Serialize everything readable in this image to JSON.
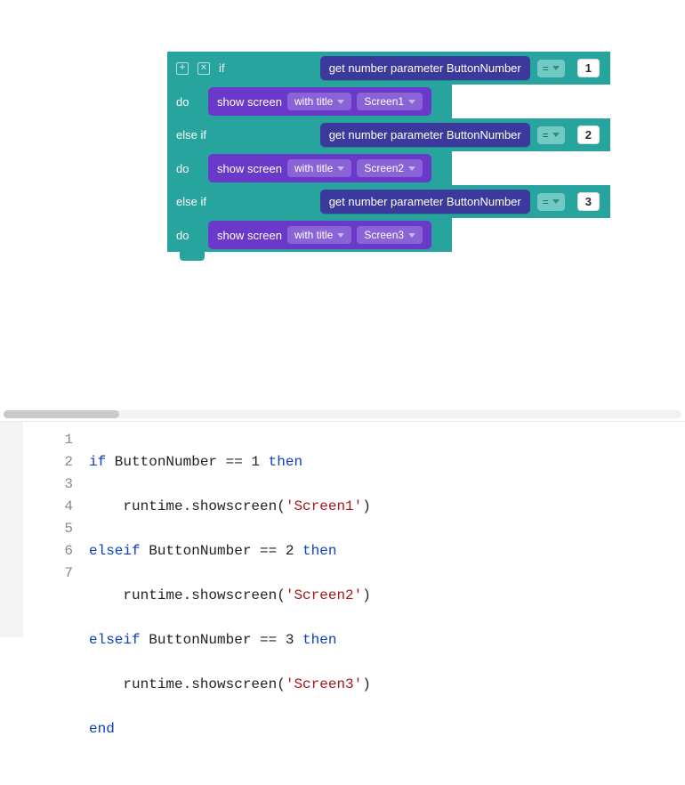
{
  "blocks": {
    "if_label": "if",
    "elseif_label": "else if",
    "do_label": "do",
    "get_param_label": "get number parameter ButtonNumber",
    "eq_label": "=",
    "show_screen_label": "show screen",
    "with_title_label": "with title",
    "branches": [
      {
        "compare_value": "1",
        "screen": "Screen1"
      },
      {
        "compare_value": "2",
        "screen": "Screen2"
      },
      {
        "compare_value": "3",
        "screen": "Screen3"
      }
    ]
  },
  "code": {
    "kw_if": "if",
    "kw_elseif": "elseif",
    "kw_then": "then",
    "kw_end": "end",
    "lines": [
      {
        "n": "1",
        "pre": "",
        "kw": "if",
        "mid": " ButtonNumber == 1 ",
        "kw2": "then",
        "post": ""
      },
      {
        "n": "2",
        "pre": "    runtime.showscreen(",
        "str": "'Screen1'",
        "post2": ")"
      },
      {
        "n": "3",
        "pre": "",
        "kw": "elseif",
        "mid": " ButtonNumber == 2 ",
        "kw2": "then",
        "post": ""
      },
      {
        "n": "4",
        "pre": "    runtime.showscreen(",
        "str": "'Screen2'",
        "post2": ")"
      },
      {
        "n": "5",
        "pre": "",
        "kw": "elseif",
        "mid": " ButtonNumber == 3 ",
        "kw2": "then",
        "post": ""
      },
      {
        "n": "6",
        "pre": "    runtime.showscreen(",
        "str": "'Screen3'",
        "post2": ")"
      },
      {
        "n": "7",
        "pre": "",
        "kw": "end",
        "mid": "",
        "kw2": "",
        "post": ""
      }
    ]
  }
}
